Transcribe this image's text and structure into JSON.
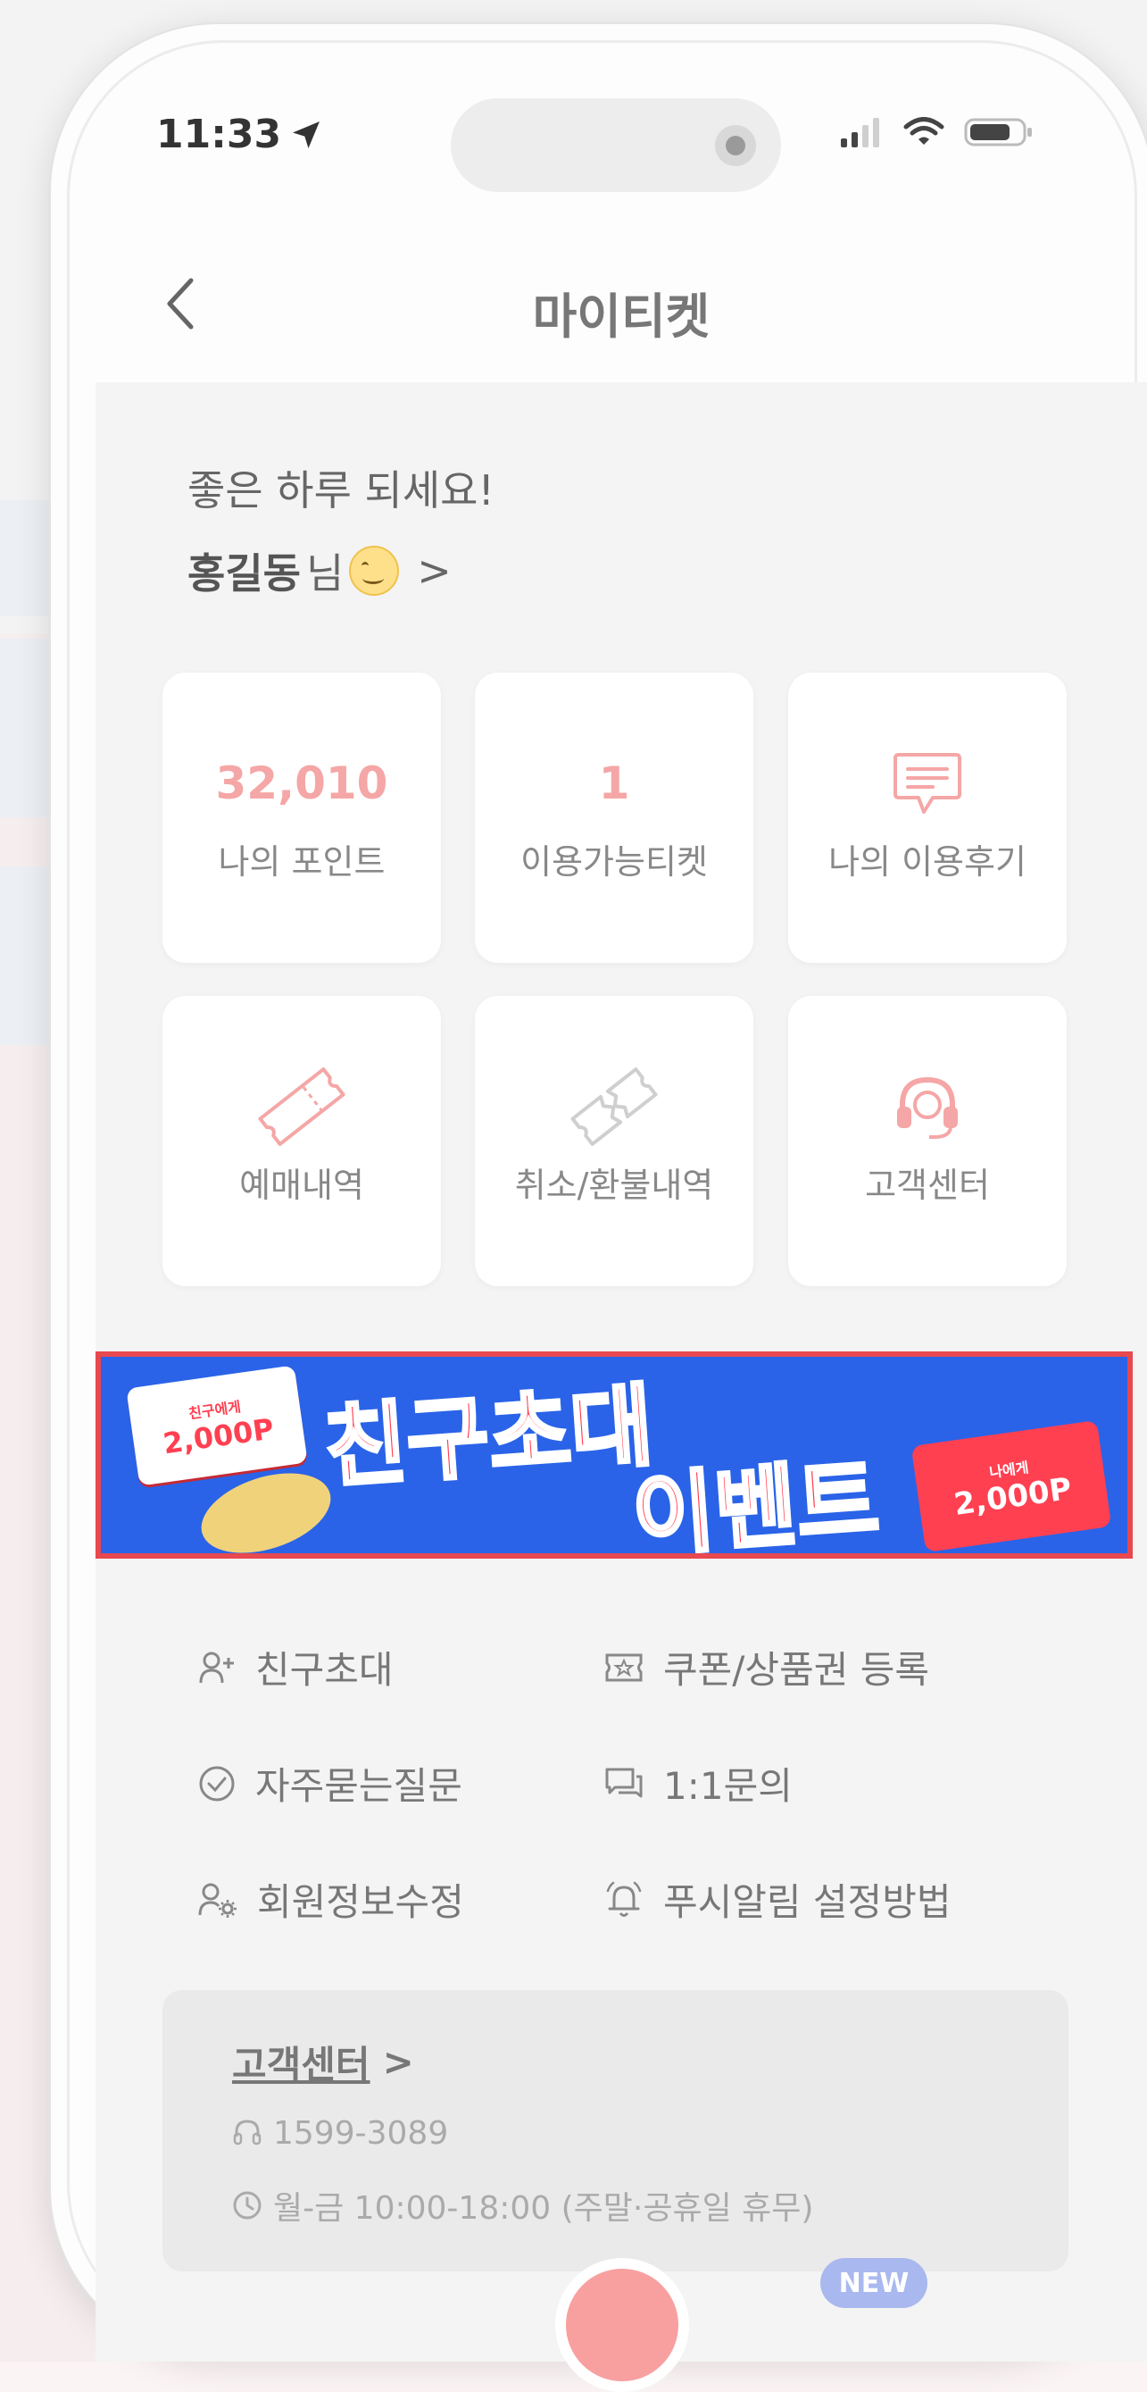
{
  "status_bar": {
    "time": "11:33"
  },
  "header": {
    "title": "마이티켓"
  },
  "greeting": {
    "line1": "좋은 하루 되세요!",
    "name": "홍길동",
    "suffix": "님",
    "arrow": ">"
  },
  "stats": {
    "points_value": "32,010",
    "points_label": "나의 포인트",
    "tickets_value": "1",
    "tickets_label": "이용가능티켓",
    "reviews_label": "나의 이용후기"
  },
  "quick_menu": {
    "reservations_label": "예매내역",
    "refunds_label": "취소/환불내역",
    "support_label": "고객센터"
  },
  "banner": {
    "title_line1": "친구초대",
    "title_line2": "이벤트",
    "left_ticket_small": "친구에게",
    "left_ticket_points": "2,000P",
    "right_ticket_small": "나에게",
    "right_ticket_points": "2,000P"
  },
  "menu": {
    "invite_friend": "친구초대",
    "coupon_register": "쿠폰/상품권 등록",
    "faq": "자주묻는질문",
    "inquiry": "1:1문의",
    "edit_profile": "회원정보수정",
    "push_settings": "푸시알림 설정방법"
  },
  "customer_center": {
    "title": "고객센터",
    "arrow": ">",
    "phone": "1599-3089",
    "hours": "월-금 10:00-18:00 (주말·공휴일 휴무)"
  },
  "tab_bar": {
    "new_badge": "NEW"
  },
  "colors": {
    "accent_pink": "#f5a6a6",
    "banner_blue": "#2a63e8",
    "banner_red": "#ff3b4e",
    "banner_border": "#e8484f"
  }
}
